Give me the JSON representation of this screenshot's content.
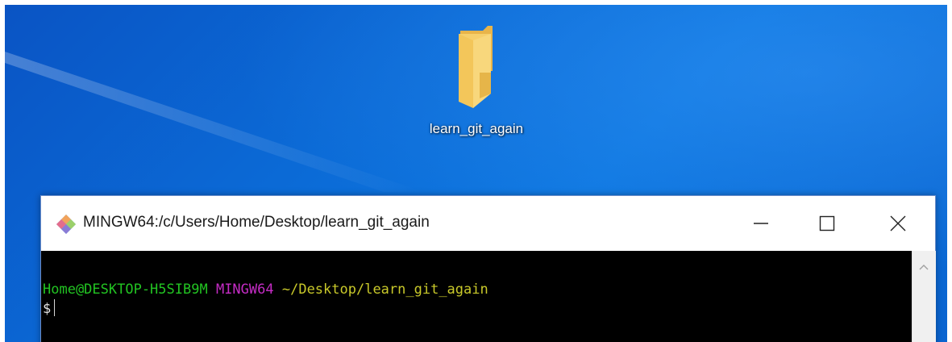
{
  "desktop": {
    "background_color": "#0b6ad6",
    "icons": [
      {
        "label": "learn_git_again",
        "icon": "folder-icon",
        "color": "#f3c65a"
      }
    ]
  },
  "terminal": {
    "title": "MINGW64:/c/Users/Home/Desktop/learn_git_again",
    "app_icon": "git-icon",
    "controls": {
      "minimize": "minimize-icon",
      "maximize": "maximize-icon",
      "close": "close-icon"
    },
    "prompt": {
      "user_host": "Home@DESKTOP-H5SIB9M",
      "environment": "MINGW64",
      "path": "~/Desktop/learn_git_again",
      "symbol": "$"
    },
    "colors": {
      "user_host": "#22c422",
      "environment": "#c52cc5",
      "path": "#c9c92a",
      "background": "#000000"
    },
    "scrollbar": {
      "up_arrow": "chevron-up-icon"
    }
  }
}
